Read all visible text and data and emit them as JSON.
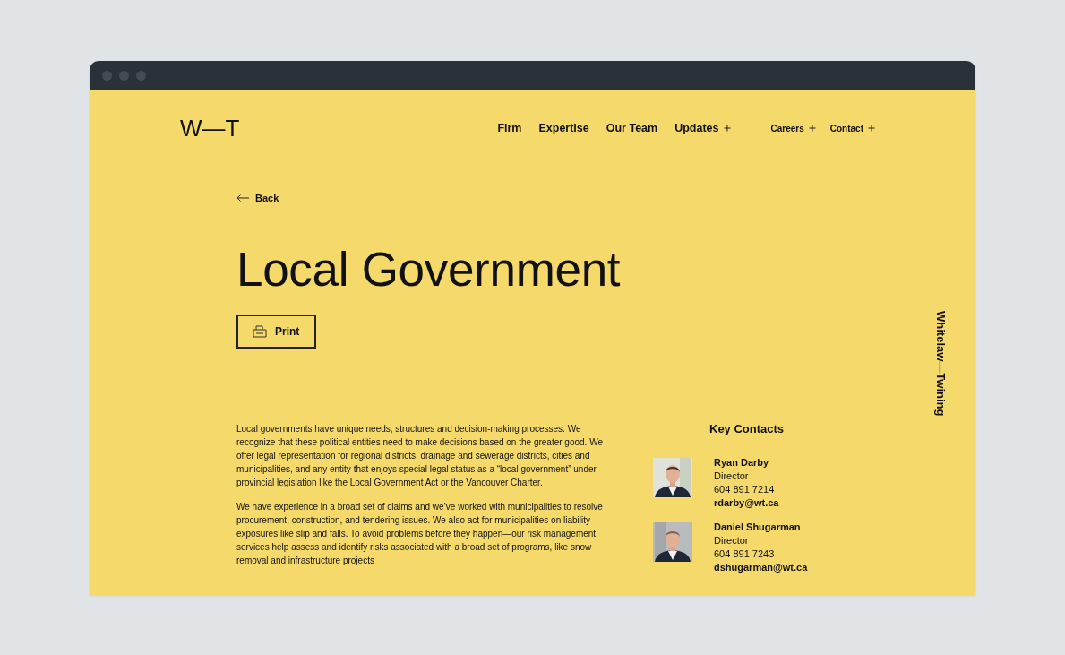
{
  "logo": "W—T",
  "nav": [
    {
      "label": "Firm",
      "has_submenu": false
    },
    {
      "label": "Expertise",
      "has_submenu": false
    },
    {
      "label": "Our Team",
      "has_submenu": false
    },
    {
      "label": "Updates",
      "has_submenu": true
    }
  ],
  "secondary_nav": [
    {
      "label": "Careers",
      "has_submenu": true
    },
    {
      "label": "Contact",
      "has_submenu": true
    }
  ],
  "back_link": "Back",
  "title": "Local Government",
  "print_button": "Print",
  "body": [
    "Local governments have unique needs, structures and decision-making processes. We recognize that these political entities need to make decisions based on the greater good. We offer legal representation for regional districts, drainage and sewerage districts, cities and municipalities, and any entity that enjoys special legal status as a “local government” under provincial legislation like the Local Government Act or the Vancouver Charter.",
    "We have experience in a broad set of claims and we’ve worked with municipalities to resolve procurement, construction, and tendering issues. We also act for municipalities on liability exposures like slip and falls. To avoid problems before they happen—our risk management services help assess and identify risks associated with a broad set of programs, like snow removal and infrastructure projects"
  ],
  "key_contacts": {
    "heading": "Key Contacts",
    "contacts": [
      {
        "name": "Ryan Darby",
        "role": "Director",
        "phone": "604 891 7214",
        "email": "rdarby@wt.ca"
      },
      {
        "name": "Daniel Shugarman",
        "role": "Director",
        "phone": "604 891 7243",
        "email": "dshugarman@wt.ca"
      }
    ]
  },
  "side_label": "Whitelaw—Twining"
}
